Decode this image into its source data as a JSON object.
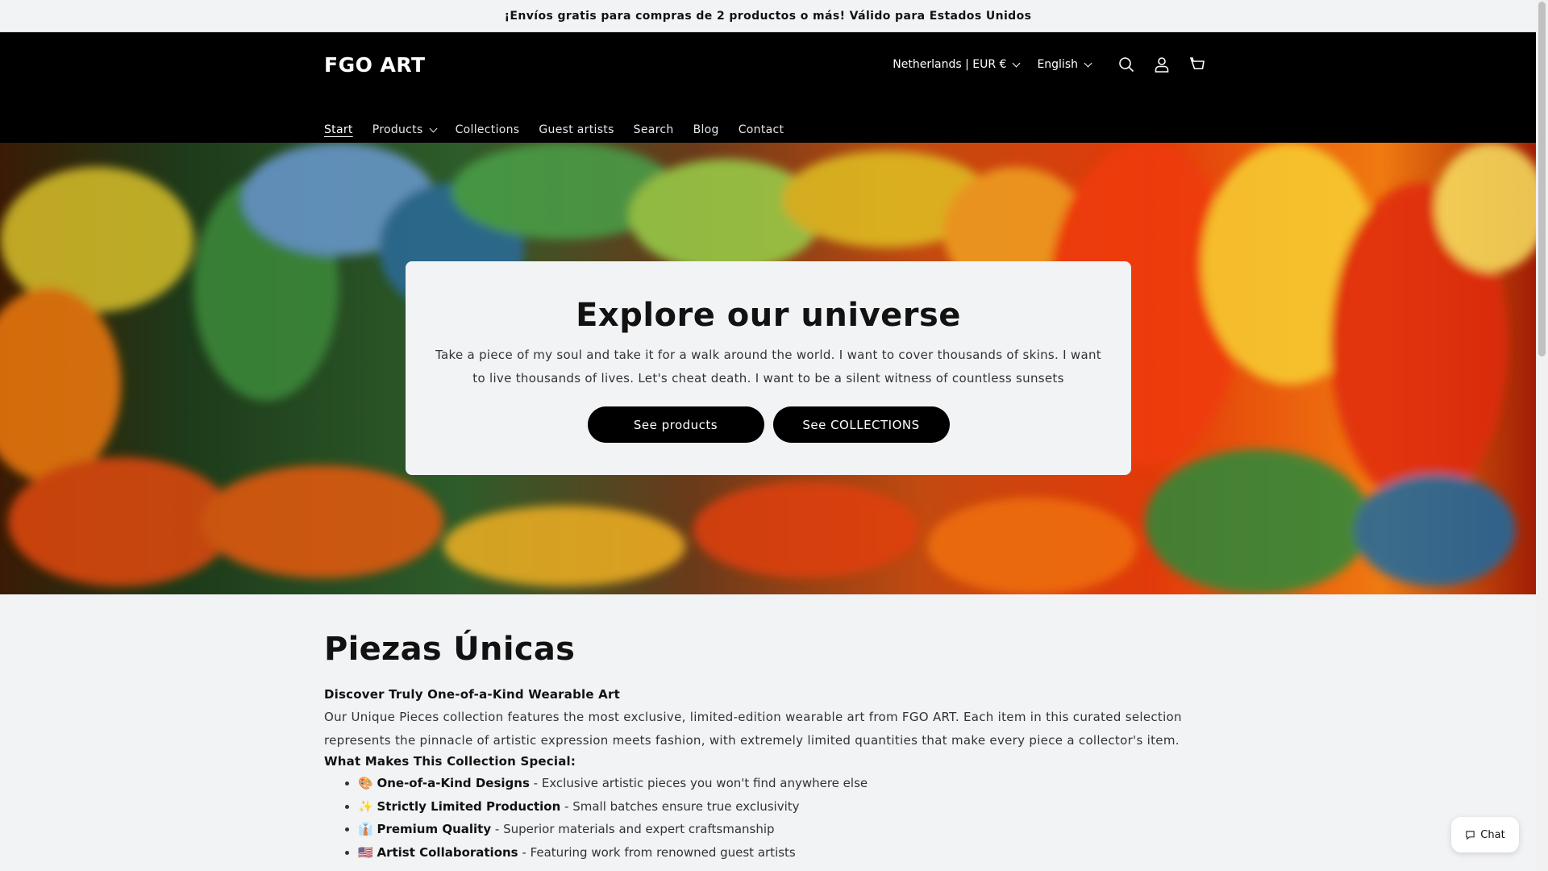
{
  "announcement": "¡Envíos gratis para compras de 2 productos o más! Válido para Estados Unidos",
  "header": {
    "logo": "FGO ART",
    "country": "Netherlands | EUR €",
    "language": "English",
    "icons": [
      "search-icon",
      "account-icon",
      "cart-icon"
    ]
  },
  "nav": {
    "items": [
      {
        "label": "Start",
        "active": true
      },
      {
        "label": "Products",
        "has_dropdown": true
      },
      {
        "label": "Collections"
      },
      {
        "label": "Guest artists"
      },
      {
        "label": "Search"
      },
      {
        "label": "Blog"
      },
      {
        "label": "Contact"
      }
    ]
  },
  "hero": {
    "title": "Explore our universe",
    "text": "Take a piece of my soul and take it for a walk around the world. I want to cover thousands of skins. I want to live thousands of lives. Let's cheat death. I want to be a silent witness of countless sunsets",
    "buttons": [
      "See products",
      "See COLLECTIONS"
    ]
  },
  "content": {
    "title": "Piezas Únicas",
    "subheading": "Discover Truly One-of-a-Kind Wearable Art",
    "paragraph": "Our Unique Pieces collection features the most exclusive, limited-edition wearable art from FGO ART. Each item in this curated selection represents the pinnacle of artistic expression meets fashion, with extremely limited quantities that make every piece a collector's item.",
    "special_heading": "What Makes This Collection Special:",
    "features": [
      {
        "emoji": "🎨",
        "title": "One-of-a-Kind Designs",
        "desc": " - Exclusive artistic pieces you won't find anywhere else"
      },
      {
        "emoji": "✨",
        "title": "Strictly Limited Production",
        "desc": " - Small batches ensure true exclusivity"
      },
      {
        "emoji": "👔",
        "title": "Premium Quality",
        "desc": " - Superior materials and expert craftsmanship"
      },
      {
        "emoji": "🇺🇸",
        "title": "Artist Collaborations",
        "desc": " - Featuring work from renowned guest artists"
      }
    ]
  },
  "chat": {
    "label": "Chat"
  },
  "colors": {
    "header_bg": "#000000",
    "page_bg": "#f2f3f5",
    "button_bg": "#000000"
  }
}
